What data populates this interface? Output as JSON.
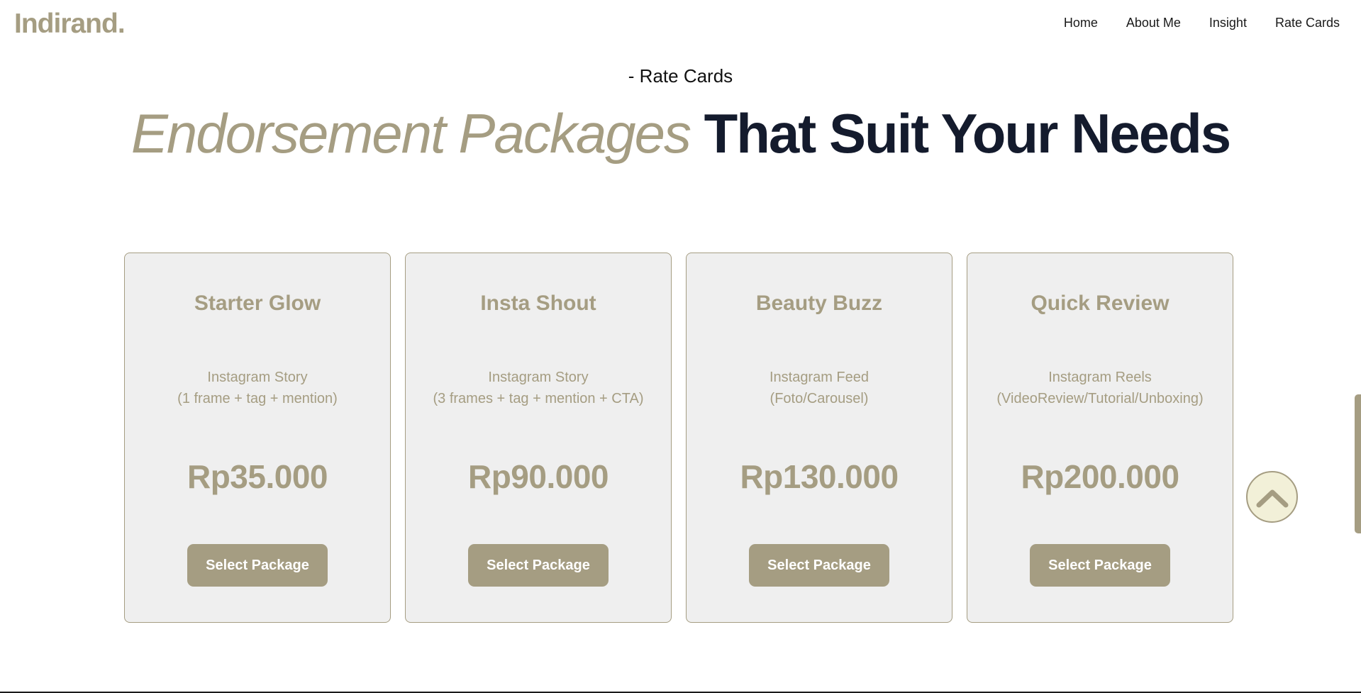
{
  "brand": {
    "logo": "Indirand."
  },
  "nav": {
    "items": [
      {
        "label": "Home"
      },
      {
        "label": "About Me"
      },
      {
        "label": "Insight"
      },
      {
        "label": "Rate Cards"
      }
    ]
  },
  "section": {
    "eyebrow": "- Rate Cards",
    "heading_accent": "Endorsement Packages",
    "heading_main": "That Suit Your Needs"
  },
  "cards": [
    {
      "title": "Starter Glow",
      "desc_line1": "Instagram Story",
      "desc_line2": "(1 frame + tag + mention)",
      "price": "Rp35.000",
      "button": "Select Package"
    },
    {
      "title": "Insta Shout",
      "desc_line1": "Instagram Story",
      "desc_line2": "(3 frames + tag + mention + CTA)",
      "price": "Rp90.000",
      "button": "Select Package"
    },
    {
      "title": "Beauty Buzz",
      "desc_line1": "Instagram Feed",
      "desc_line2": "(Foto/Carousel)",
      "price": "Rp130.000",
      "button": "Select Package"
    },
    {
      "title": "Quick Review",
      "desc_line1": "Instagram Reels",
      "desc_line2": "(VideoReview/Tutorial/Unboxing)",
      "price": "Rp200.000",
      "button": "Select Package"
    }
  ],
  "icons": {
    "back_to_top": "chevron-up-icon"
  },
  "colors": {
    "accent": "#a59d82",
    "heading_dark": "#141b2d",
    "card_bg": "#efefef",
    "back_to_top_bg": "#f2f0d8"
  }
}
